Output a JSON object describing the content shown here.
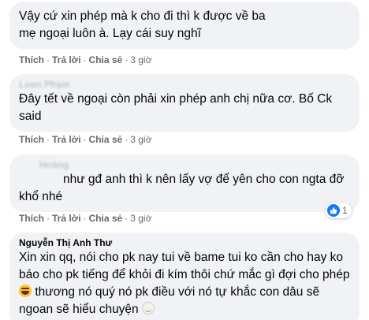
{
  "actions": {
    "like": "Thích",
    "reply": "Trả lời",
    "share": "Chia sẻ",
    "separator": "·"
  },
  "comments": [
    {
      "author": "",
      "text": "Vậy cứ xin phép mà k cho đi thì k được về ba mẹ ngoại luôn à. Lạy cái suy nghĩ",
      "time": "3 giờ"
    },
    {
      "author": "Loan Phạm",
      "text": "Đây tết về ngoại còn phải xin phép anh chị nữa cơ. Bố Ck said",
      "time": "3 giờ"
    },
    {
      "author": "Hoàng",
      "text": "như gđ anh thì k nên lấy vợ để yên cho con ngta đỡ khổ nhé",
      "time": "3 giờ",
      "reaction_icon": "like-icon",
      "reaction_count": "1"
    },
    {
      "author": "Nguyễn Thị Anh Thư",
      "text_part1": "Xin xin qq, nói cho pk nay tui về bame tui ko cần cho hay ko báo cho pk tiếng để khỏi đi kím thôi chứ mắc gì đợi cho phép",
      "text_part2": "thương nó quý nó pk điều với nó tự khắc con dâu sẽ ngoan sẽ hiểu chuyện",
      "emoji1": "laughing-emoji-icon",
      "emoji2": "smile-emoji-icon"
    }
  ],
  "colors": {
    "bubble": "#f0f2f5",
    "meta": "#65676b",
    "like": "#1877f2"
  }
}
